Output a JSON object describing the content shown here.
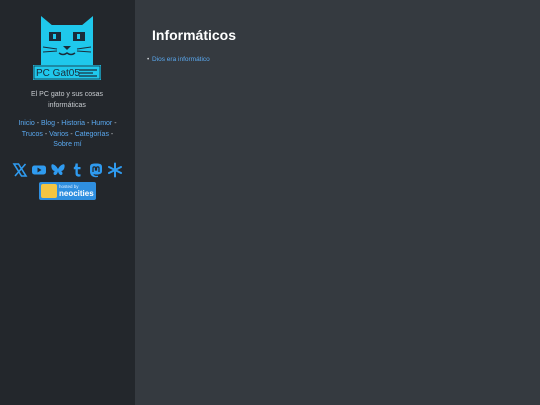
{
  "sidebar": {
    "logo_text": "PC Gat05",
    "tagline": "El PC gato y sus cosas informáticas",
    "nav": [
      {
        "label": "Inicio"
      },
      {
        "label": "Blog"
      },
      {
        "label": "Historia"
      },
      {
        "label": "Humor"
      },
      {
        "label": "Trucos"
      },
      {
        "label": "Varios"
      },
      {
        "label": "Categorías"
      },
      {
        "label": "Sobre mí"
      }
    ],
    "nav_separator": " - ",
    "social_icons": [
      "x-icon",
      "youtube-icon",
      "bluesky-icon",
      "tumblr-icon",
      "mastodon-icon",
      "asterisk-icon"
    ],
    "badge": {
      "small": "hosted by",
      "big": "neocities"
    }
  },
  "main": {
    "title": "Informáticos",
    "links": [
      {
        "label": "Dios era informático"
      }
    ]
  },
  "colors": {
    "sidebar_bg": "#23272c",
    "main_bg": "#353a40",
    "link": "#5aa9f0",
    "logo_cyan": "#1fc8ec"
  }
}
